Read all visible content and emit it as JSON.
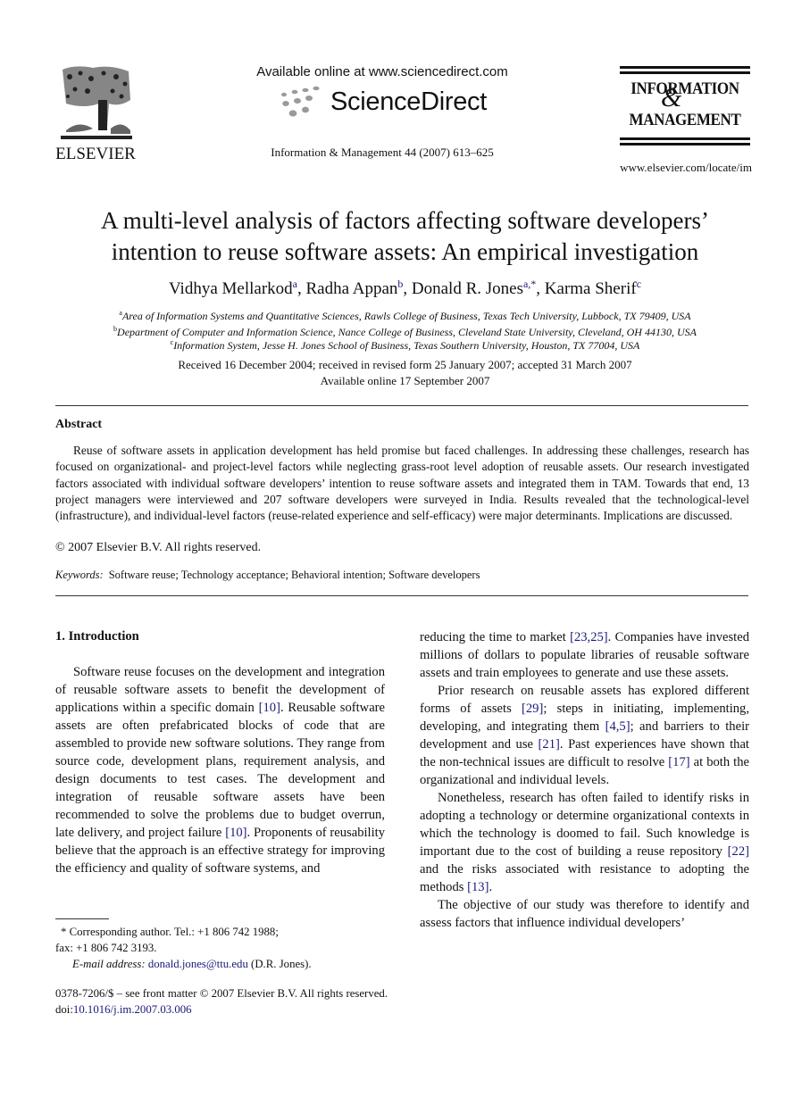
{
  "header": {
    "publisher_logo": {
      "icon": "elsevier-tree-icon",
      "wordmark": "ELSEVIER"
    },
    "sd_available": "Available online at www.sciencedirect.com",
    "sd_logo": {
      "icon": "sciencedirect-dots-icon",
      "name": "ScienceDirect"
    },
    "journal_ref": "Information & Management 44 (2007) 613–625",
    "journal_logo": {
      "line1": "INFORMATION",
      "ampersand": "&",
      "line2": "MANAGEMENT"
    },
    "journal_url": "www.elsevier.com/locate/im"
  },
  "article": {
    "title_line1": "A multi-level analysis of factors affecting software developers’",
    "title_line2": "intention to reuse software assets: An empirical investigation",
    "authors": [
      {
        "name": "Vidhya Mellarkod",
        "aff": "a",
        "sep": ", "
      },
      {
        "name": "Radha Appan",
        "aff": "b",
        "sep": ", "
      },
      {
        "name": "Donald R. Jones",
        "aff": "a,*",
        "sep": ", "
      },
      {
        "name": "Karma Sherif",
        "aff": "c",
        "sep": ""
      }
    ],
    "affiliations": [
      {
        "mark": "a",
        "text": "Area of Information Systems and Quantitative Sciences, Rawls College of Business, Texas Tech University, Lubbock, TX 79409, USA"
      },
      {
        "mark": "b",
        "text": "Department of Computer and Information Science, Nance College of Business, Cleveland State University, Cleveland, OH 44130, USA"
      },
      {
        "mark": "c",
        "text": "Information System, Jesse H. Jones School of Business, Texas Southern University, Houston, TX 77004, USA"
      }
    ],
    "dates_line1": "Received 16 December 2004; received in revised form 25 January 2007; accepted 31 March 2007",
    "dates_line2": "Available online 17 September 2007"
  },
  "abstract": {
    "heading": "Abstract",
    "body": "Reuse of software assets in application development has held promise but faced challenges. In addressing these challenges, research has focused on organizational- and project-level factors while neglecting grass-root level adoption of reusable assets. Our research investigated factors associated with individual software developers’ intention to reuse software assets and integrated them in TAM. Towards that end, 13 project managers were interviewed and 207 software developers were surveyed in India. Results revealed that the technological-level (infrastructure), and individual-level factors (reuse-related experience and self-efficacy) were major determinants. Implications are discussed.",
    "copyright": "© 2007 Elsevier B.V. All rights reserved.",
    "keywords_label": "Keywords:",
    "keywords": "Software reuse; Technology acceptance; Behavioral intention; Software developers"
  },
  "intro": {
    "heading": "1.  Introduction",
    "left_p1": [
      {
        "t": "Software reuse focuses on the development and integration of reusable software assets to benefit the development of applications within a specific domain "
      },
      {
        "ref": "[10]"
      },
      {
        "t": ". Reusable software assets are often prefabricated blocks of code that are assembled to provide new software solutions. They range from source code, development plans, requirement analysis, and design documents to test cases. The development and integration of reusable software assets have been recommended to solve the problems due to budget overrun, late delivery, and project failure "
      },
      {
        "ref": "[10]"
      },
      {
        "t": ". Proponents of reusability believe that the approach is an effective strategy for improving the efficiency and quality of software systems, and"
      }
    ],
    "right_p0": [
      {
        "t": "reducing the time to market "
      },
      {
        "ref": "[23,25]"
      },
      {
        "t": ". Companies have invested millions of dollars to populate libraries of reusable software assets and train employees to generate and use these assets."
      }
    ],
    "right_p1": [
      {
        "t": "Prior research on reusable assets has explored different forms of assets "
      },
      {
        "ref": "[29]"
      },
      {
        "t": "; steps in initiating, implementing, developing, and integrating them "
      },
      {
        "ref": "[4,5]"
      },
      {
        "t": "; and barriers to their development and use "
      },
      {
        "ref": "[21]"
      },
      {
        "t": ". Past experiences have shown that the non-technical issues are difficult to resolve "
      },
      {
        "ref": "[17]"
      },
      {
        "t": " at both the organizational and individual levels."
      }
    ],
    "right_p2": [
      {
        "t": "Nonetheless, research has often failed to identify risks in adopting a technology or determine organizational contexts in which the technology is doomed to fail. Such knowledge is important due to the cost of building a reuse repository "
      },
      {
        "ref": "[22]"
      },
      {
        "t": " and the risks associated with resistance to adopting the methods "
      },
      {
        "ref": "[13]"
      },
      {
        "t": "."
      }
    ],
    "right_p3": [
      {
        "t": "The objective of our study was therefore to identify and assess factors that influence individual developers’"
      }
    ]
  },
  "footnotes": {
    "corresponding": "* Corresponding author. Tel.: +1 806 742 1988;",
    "fax": "fax: +1 806 742 3193.",
    "email_label": "E-mail address:",
    "email": "donald.jones@ttu.edu",
    "email_suffix": " (D.R. Jones).",
    "front_matter": "0378-7206/$ – see front matter © 2007 Elsevier B.V. All rights reserved.",
    "doi_prefix": "doi:",
    "doi": "10.1016/j.im.2007.03.006"
  },
  "colors": {
    "link": "#1a1a7a",
    "text": "#111111",
    "sd_dots": "#9a9a9a"
  }
}
